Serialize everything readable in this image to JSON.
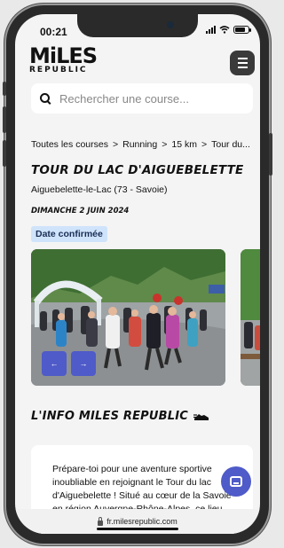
{
  "status_bar": {
    "time": "00:21",
    "battery_level": 0.75
  },
  "header": {
    "logo_main": "MiLES",
    "logo_sub": "REPUBLIC"
  },
  "search": {
    "placeholder": "Rechercher une course..."
  },
  "breadcrumb": {
    "items": [
      "Toutes les courses",
      "Running",
      "15 km",
      "Tour du..."
    ],
    "separator": ">"
  },
  "race": {
    "title": "TOUR DU LAC D'AIGUEBELETTE",
    "location": "Aiguebelette-le-Lac (73 - Savoie)",
    "date": "DIMANCHE 2 JUIN 2024",
    "date_status": "Date confirmée"
  },
  "carousel": {
    "prev_label": "←",
    "next_label": "→"
  },
  "info": {
    "section_title": "L'INFO MILES REPUBLIC",
    "text": "Prépare-toi pour une aventure sportive inoubliable en rejoignant le Tour du lac d'Aiguebelette ! Situé au cœur de la Savoie en région Auvergne-Rhône-Alpes, ce lieu"
  },
  "browser": {
    "url": "fr.milesrepublic.com"
  },
  "colors": {
    "accent": "#4f5bc8",
    "badge_bg": "#cfe3fb"
  }
}
